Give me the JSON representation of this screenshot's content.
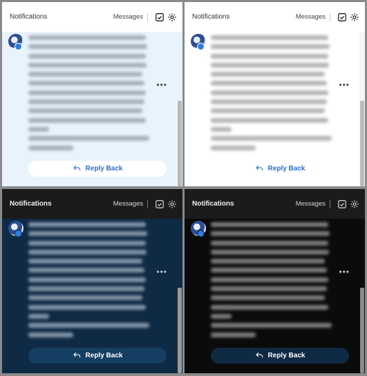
{
  "panels": [
    {
      "theme": "light-blue",
      "title": "Notifications",
      "messages_label": "Messages",
      "reply_label": "Reply Back"
    },
    {
      "theme": "light",
      "title": "Notifications",
      "messages_label": "Messages",
      "reply_label": "Reply Back"
    },
    {
      "theme": "dark-blue",
      "title": "Notifications",
      "messages_label": "Messages",
      "reply_label": "Reply Back"
    },
    {
      "theme": "dark",
      "title": "Notifications",
      "messages_label": "Messages",
      "reply_label": "Reply Back"
    }
  ],
  "icons": {
    "mark_read": "check-square-icon",
    "settings": "gear-icon",
    "more": "more-options-icon",
    "reply": "reply-arrow-icon"
  },
  "colors": {
    "accent": "#2a6ed3",
    "dark_blue_bg": "#0f2a44",
    "light_blue_bg": "#e9f3fc"
  }
}
